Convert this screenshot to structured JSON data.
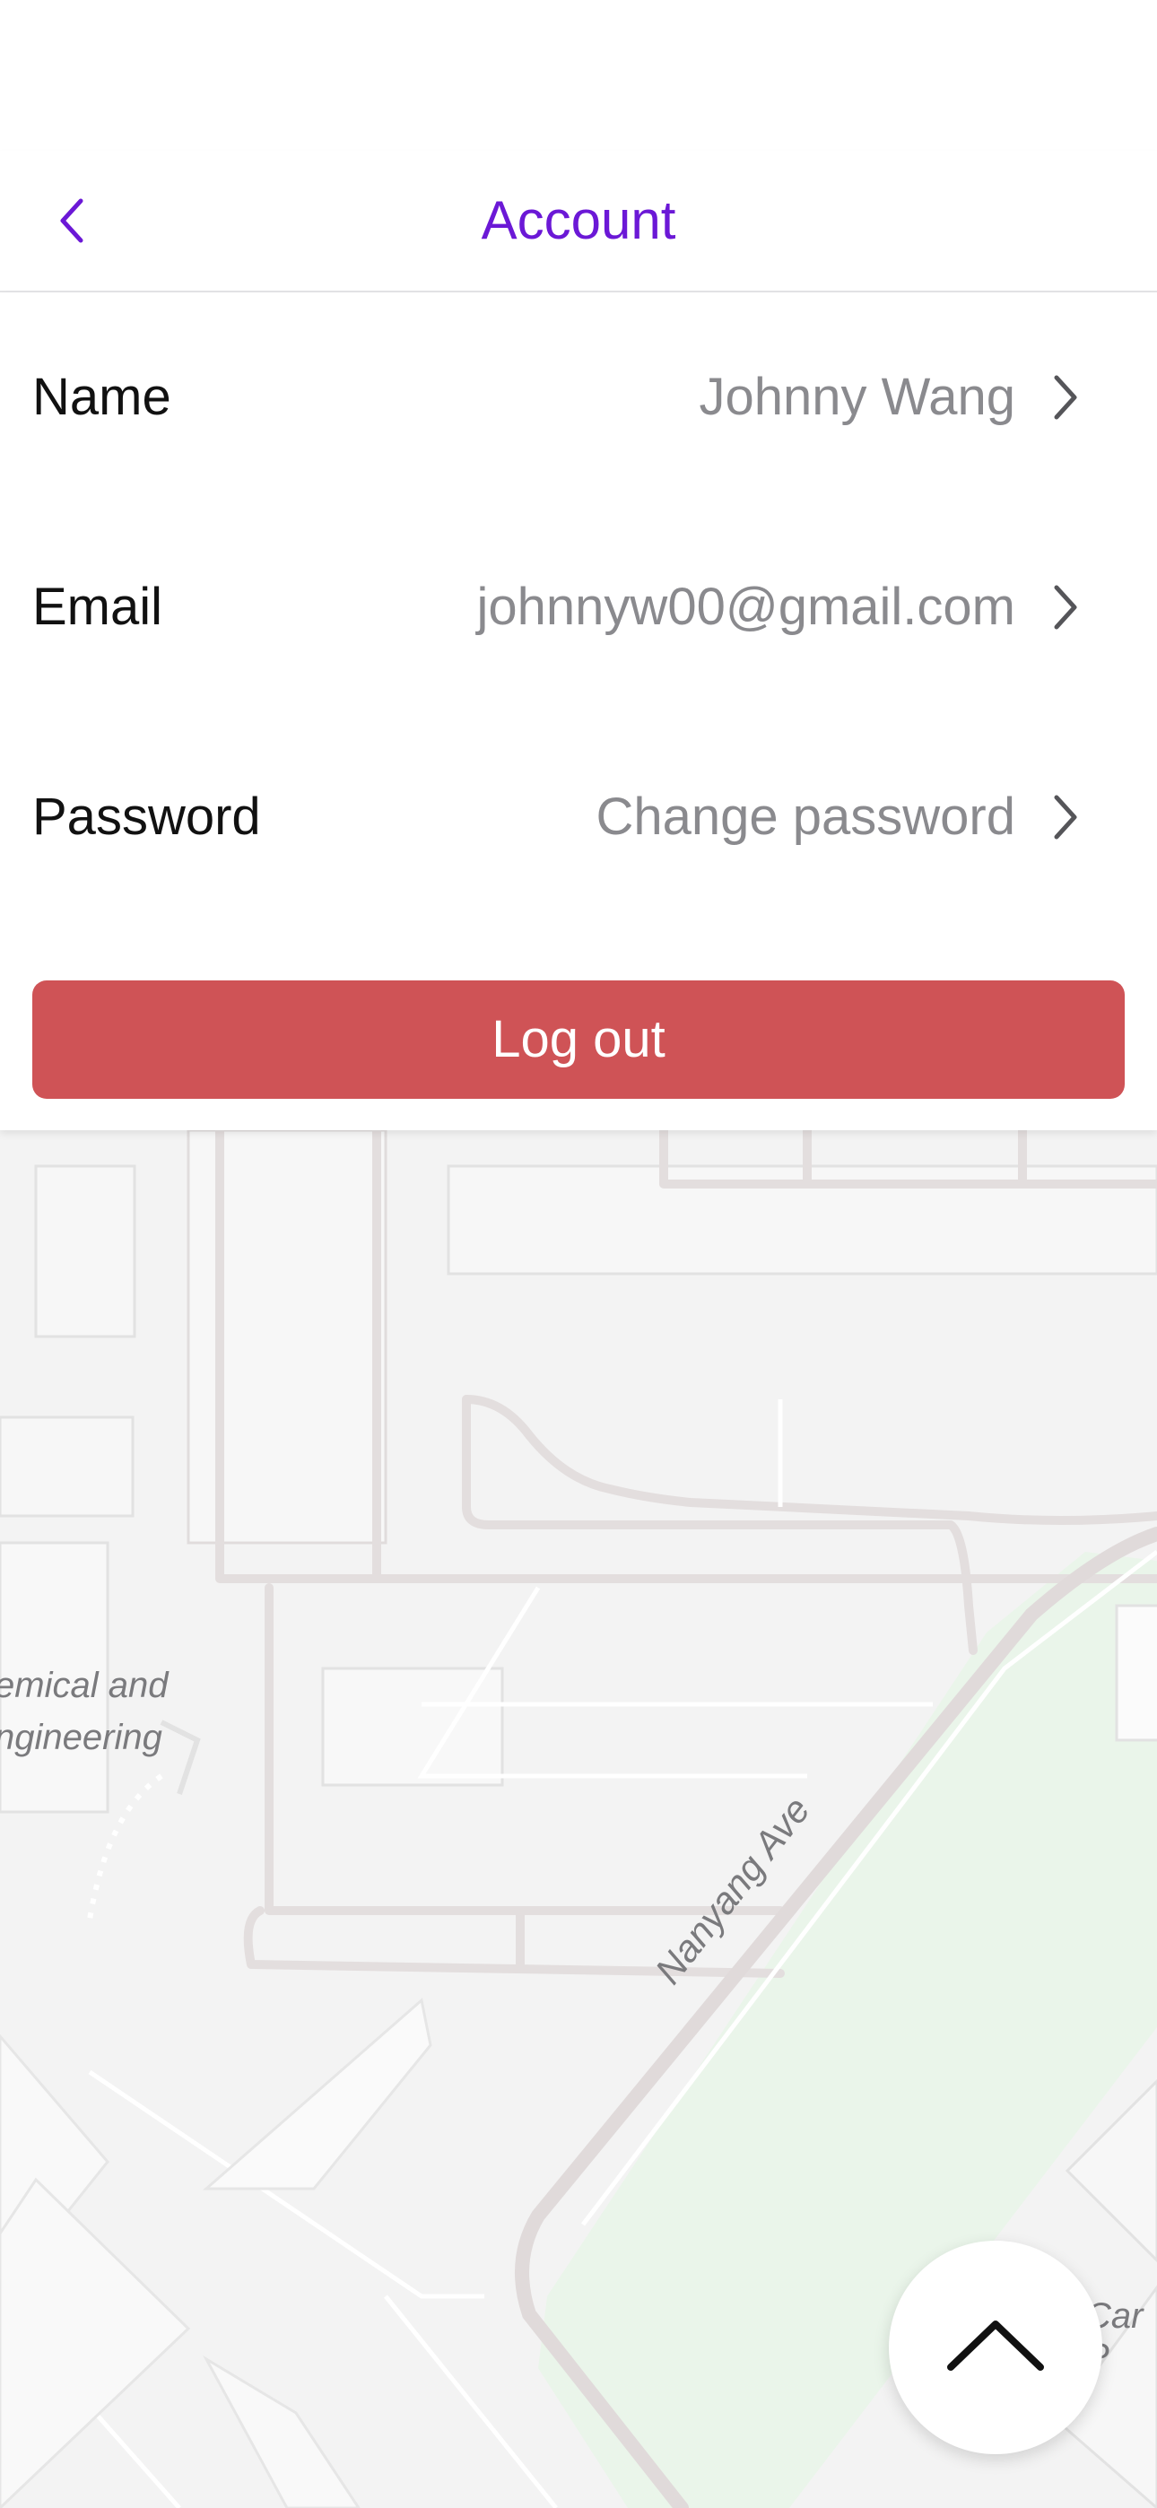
{
  "header": {
    "title": "Account",
    "back_icon": "chevron-left-icon",
    "accent": "#6b18d6"
  },
  "account": {
    "rows": [
      {
        "label": "Name",
        "value": "Johnny Wang"
      },
      {
        "label": "Email",
        "value": "johnnyw00@gmail.com"
      },
      {
        "label": "Password",
        "value": "Change password"
      }
    ],
    "row_icon": "chevron-right-icon"
  },
  "logout": {
    "label": "Log out",
    "color": "#cf5356"
  },
  "map": {
    "labels": {
      "building_line1": "emical and",
      "building_line2": "ngineering",
      "street": "Nanyang Ave",
      "corner": "Car P"
    },
    "park_color": "#eaf5ea"
  },
  "fab": {
    "icon": "chevron-up-icon"
  }
}
